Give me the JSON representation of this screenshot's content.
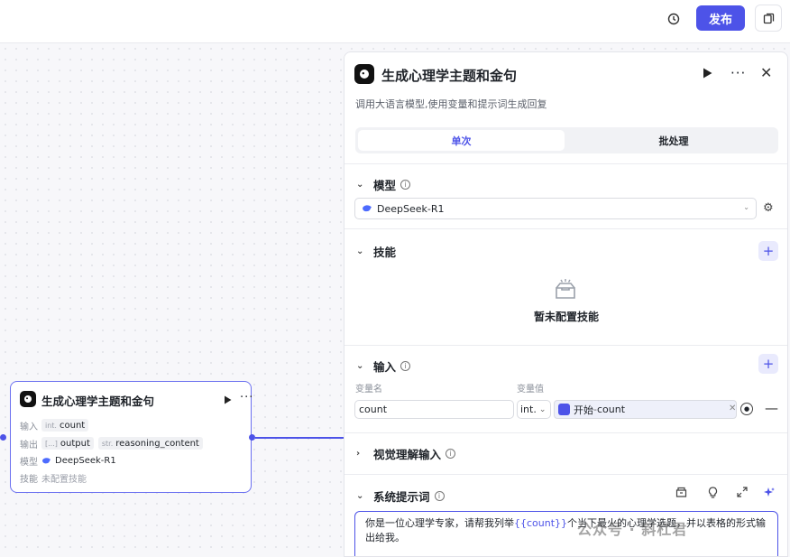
{
  "topbar": {
    "history_icon": "history-icon",
    "publish_label": "发布",
    "copy_icon": "copy-icon"
  },
  "canvas_node": {
    "title": "生成心理学主题和金句",
    "input_label": "输入",
    "input_type": "int.",
    "input_name": "count",
    "output_label": "输出",
    "output_type_1": "[...]",
    "output_name_1": "output",
    "output_type_2": "str.",
    "output_name_2": "reasoning_content",
    "model_label": "模型",
    "model_name": "DeepSeek-R1",
    "skill_label": "技能",
    "skill_value": "未配置技能"
  },
  "panel": {
    "title": "生成心理学主题和金句",
    "description": "调用大语言模型,使用变量和提示词生成回复",
    "tabs": [
      {
        "label": "单次",
        "active": true
      },
      {
        "label": "批处理",
        "active": false
      }
    ],
    "model_section": {
      "title": "模型",
      "selected_model": "DeepSeek-R1"
    },
    "skill_section": {
      "title": "技能",
      "empty_text": "暂未配置技能"
    },
    "input_section": {
      "title": "输入",
      "col_name": "变量名",
      "col_value": "变量值",
      "rows": [
        {
          "name": "count",
          "type": "int.",
          "ref_node": "开始",
          "ref_sep": " - ",
          "ref_var": "count"
        }
      ]
    },
    "vision_section": {
      "title": "视觉理解输入"
    },
    "system_prompt": {
      "title": "系统提示词",
      "text_before": "你是一位心理学专家，请帮我列举",
      "variable": "{{count}}",
      "text_after": "个当下最火的心理学选题，并以表格的形式输出给我。"
    }
  },
  "watermark": "公众号 · 斜杠君",
  "colors": {
    "accent": "#4d53e8",
    "canvas_bg": "#f7f7fa"
  }
}
